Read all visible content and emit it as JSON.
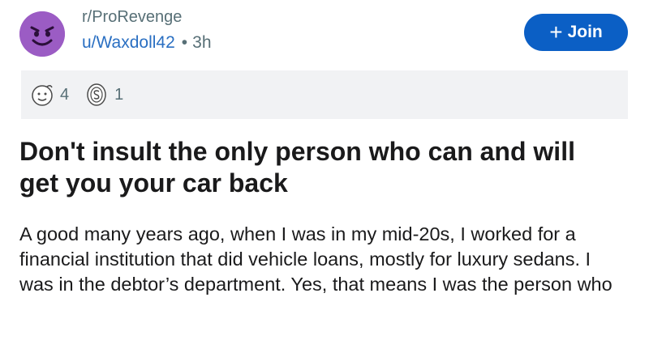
{
  "subreddit": "r/ProRevenge",
  "author": "u/Waxdoll42",
  "separator": "•",
  "time_ago": "3h",
  "join_button": {
    "icon": "plus-icon",
    "label": "Join"
  },
  "awards": [
    {
      "icon": "face-award-icon",
      "count": "4"
    },
    {
      "icon": "coin-award-icon",
      "count": "1"
    }
  ],
  "post": {
    "title": "Don't insult the only person who can and will get you your car back",
    "body": "A good many years ago, when I was in my mid-20s, I worked for a financial institution that did vehicle loans, mostly for luxury sedans. I was in the debtor’s department. Yes, that means I was the person who"
  },
  "colors": {
    "accent": "#0b5fc5",
    "avatar": "#9b5cc4",
    "link": "#2a6fc2",
    "awards_bg": "#f1f2f4"
  }
}
